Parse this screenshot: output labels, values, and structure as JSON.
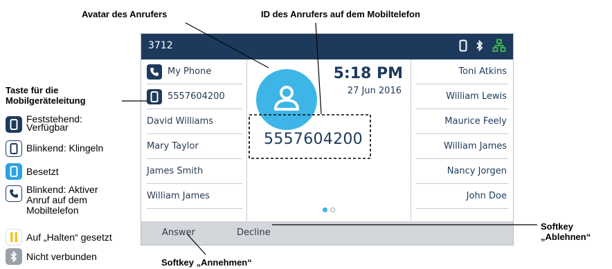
{
  "callouts": {
    "avatar": "Avatar des Anrufers",
    "caller_id": "ID des Anrufers auf dem Mobiltelefon",
    "mobile_key": "Taste für die\nMobilgeräteleitung",
    "decline": "Softkey\n„Ablehnen“",
    "answer": "Softkey „Annehmen“"
  },
  "topbar": {
    "extension": "3712",
    "icons": [
      "mobile-icon",
      "bluetooth-icon",
      "network-icon"
    ],
    "network_color": "#3fc04a"
  },
  "left_keys": [
    {
      "label": "My Phone",
      "icon": "handset-icon"
    },
    {
      "label": "5557604200",
      "icon": "mobile-icon"
    },
    {
      "label": "David Williams"
    },
    {
      "label": "Mary Taylor"
    },
    {
      "label": "James Smith"
    },
    {
      "label": "William James"
    }
  ],
  "center": {
    "time": "5:18 PM",
    "date": "27 Jun 2016",
    "caller_number": "5557604200",
    "avatar_icon": "person-icon",
    "avatar_color": "#3eb5e7",
    "page_indicator": {
      "current": 1,
      "total": 2
    }
  },
  "right_keys": [
    {
      "label": "Toni Atkins"
    },
    {
      "label": "William Lewis"
    },
    {
      "label": "Maurice Feely"
    },
    {
      "label": "William James"
    },
    {
      "label": "Nancy Jorgen"
    },
    {
      "label": "John Doe"
    }
  ],
  "softkeys": {
    "answer": "Answer",
    "decline": "Decline"
  },
  "legend": [
    {
      "icon": "mobile-solid-icon",
      "text": "Feststehend:\nVerfügbar",
      "color": "#1d3a5c"
    },
    {
      "icon": "mobile-outline-icon",
      "text": "Blinkend: Klingeln",
      "color": "#1d3a5c"
    },
    {
      "icon": "mobile-busy-icon",
      "text": "Besetzt",
      "color": "#2aa3e0"
    },
    {
      "icon": "handset-outline-icon",
      "text": "Blinkend: Aktiver\nAnruf auf dem\nMobiltelefon",
      "color": "#1d3a5c"
    },
    {
      "icon": "hold-icon",
      "text": "Auf „Halten“ gesetzt",
      "color": "#f3c623"
    },
    {
      "icon": "bluetooth-disconnected-icon",
      "text": "Nicht verbunden",
      "color": "#9aa0a6"
    }
  ],
  "colors": {
    "navy": "#1d3a5c",
    "accent": "#3eb5e7",
    "softbar": "#d3d6da"
  }
}
